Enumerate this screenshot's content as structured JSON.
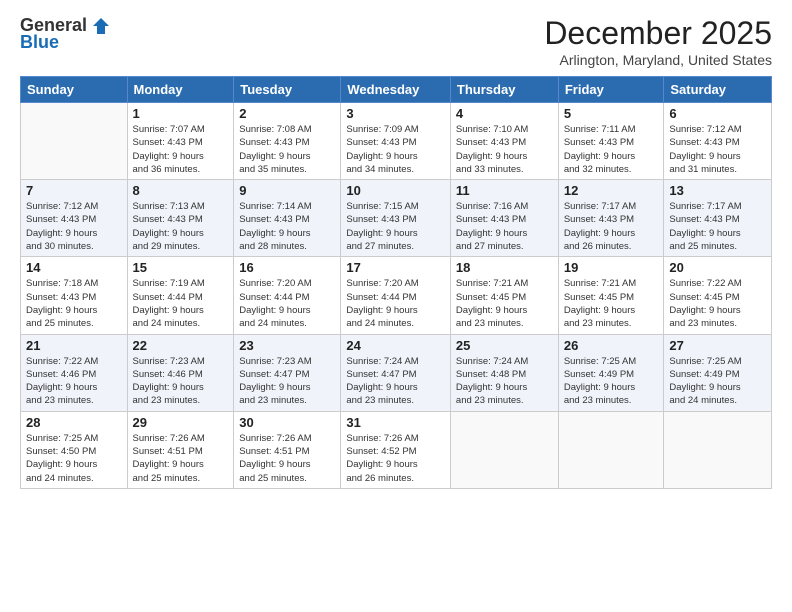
{
  "logo": {
    "general": "General",
    "blue": "Blue"
  },
  "header": {
    "month": "December 2025",
    "location": "Arlington, Maryland, United States"
  },
  "days_of_week": [
    "Sunday",
    "Monday",
    "Tuesday",
    "Wednesday",
    "Thursday",
    "Friday",
    "Saturday"
  ],
  "weeks": [
    [
      {
        "num": "",
        "info": ""
      },
      {
        "num": "1",
        "info": "Sunrise: 7:07 AM\nSunset: 4:43 PM\nDaylight: 9 hours\nand 36 minutes."
      },
      {
        "num": "2",
        "info": "Sunrise: 7:08 AM\nSunset: 4:43 PM\nDaylight: 9 hours\nand 35 minutes."
      },
      {
        "num": "3",
        "info": "Sunrise: 7:09 AM\nSunset: 4:43 PM\nDaylight: 9 hours\nand 34 minutes."
      },
      {
        "num": "4",
        "info": "Sunrise: 7:10 AM\nSunset: 4:43 PM\nDaylight: 9 hours\nand 33 minutes."
      },
      {
        "num": "5",
        "info": "Sunrise: 7:11 AM\nSunset: 4:43 PM\nDaylight: 9 hours\nand 32 minutes."
      },
      {
        "num": "6",
        "info": "Sunrise: 7:12 AM\nSunset: 4:43 PM\nDaylight: 9 hours\nand 31 minutes."
      }
    ],
    [
      {
        "num": "7",
        "info": "Sunrise: 7:12 AM\nSunset: 4:43 PM\nDaylight: 9 hours\nand 30 minutes."
      },
      {
        "num": "8",
        "info": "Sunrise: 7:13 AM\nSunset: 4:43 PM\nDaylight: 9 hours\nand 29 minutes."
      },
      {
        "num": "9",
        "info": "Sunrise: 7:14 AM\nSunset: 4:43 PM\nDaylight: 9 hours\nand 28 minutes."
      },
      {
        "num": "10",
        "info": "Sunrise: 7:15 AM\nSunset: 4:43 PM\nDaylight: 9 hours\nand 27 minutes."
      },
      {
        "num": "11",
        "info": "Sunrise: 7:16 AM\nSunset: 4:43 PM\nDaylight: 9 hours\nand 27 minutes."
      },
      {
        "num": "12",
        "info": "Sunrise: 7:17 AM\nSunset: 4:43 PM\nDaylight: 9 hours\nand 26 minutes."
      },
      {
        "num": "13",
        "info": "Sunrise: 7:17 AM\nSunset: 4:43 PM\nDaylight: 9 hours\nand 25 minutes."
      }
    ],
    [
      {
        "num": "14",
        "info": "Sunrise: 7:18 AM\nSunset: 4:43 PM\nDaylight: 9 hours\nand 25 minutes."
      },
      {
        "num": "15",
        "info": "Sunrise: 7:19 AM\nSunset: 4:44 PM\nDaylight: 9 hours\nand 24 minutes."
      },
      {
        "num": "16",
        "info": "Sunrise: 7:20 AM\nSunset: 4:44 PM\nDaylight: 9 hours\nand 24 minutes."
      },
      {
        "num": "17",
        "info": "Sunrise: 7:20 AM\nSunset: 4:44 PM\nDaylight: 9 hours\nand 24 minutes."
      },
      {
        "num": "18",
        "info": "Sunrise: 7:21 AM\nSunset: 4:45 PM\nDaylight: 9 hours\nand 23 minutes."
      },
      {
        "num": "19",
        "info": "Sunrise: 7:21 AM\nSunset: 4:45 PM\nDaylight: 9 hours\nand 23 minutes."
      },
      {
        "num": "20",
        "info": "Sunrise: 7:22 AM\nSunset: 4:45 PM\nDaylight: 9 hours\nand 23 minutes."
      }
    ],
    [
      {
        "num": "21",
        "info": "Sunrise: 7:22 AM\nSunset: 4:46 PM\nDaylight: 9 hours\nand 23 minutes."
      },
      {
        "num": "22",
        "info": "Sunrise: 7:23 AM\nSunset: 4:46 PM\nDaylight: 9 hours\nand 23 minutes."
      },
      {
        "num": "23",
        "info": "Sunrise: 7:23 AM\nSunset: 4:47 PM\nDaylight: 9 hours\nand 23 minutes."
      },
      {
        "num": "24",
        "info": "Sunrise: 7:24 AM\nSunset: 4:47 PM\nDaylight: 9 hours\nand 23 minutes."
      },
      {
        "num": "25",
        "info": "Sunrise: 7:24 AM\nSunset: 4:48 PM\nDaylight: 9 hours\nand 23 minutes."
      },
      {
        "num": "26",
        "info": "Sunrise: 7:25 AM\nSunset: 4:49 PM\nDaylight: 9 hours\nand 23 minutes."
      },
      {
        "num": "27",
        "info": "Sunrise: 7:25 AM\nSunset: 4:49 PM\nDaylight: 9 hours\nand 24 minutes."
      }
    ],
    [
      {
        "num": "28",
        "info": "Sunrise: 7:25 AM\nSunset: 4:50 PM\nDaylight: 9 hours\nand 24 minutes."
      },
      {
        "num": "29",
        "info": "Sunrise: 7:26 AM\nSunset: 4:51 PM\nDaylight: 9 hours\nand 25 minutes."
      },
      {
        "num": "30",
        "info": "Sunrise: 7:26 AM\nSunset: 4:51 PM\nDaylight: 9 hours\nand 25 minutes."
      },
      {
        "num": "31",
        "info": "Sunrise: 7:26 AM\nSunset: 4:52 PM\nDaylight: 9 hours\nand 26 minutes."
      },
      {
        "num": "",
        "info": ""
      },
      {
        "num": "",
        "info": ""
      },
      {
        "num": "",
        "info": ""
      }
    ]
  ]
}
